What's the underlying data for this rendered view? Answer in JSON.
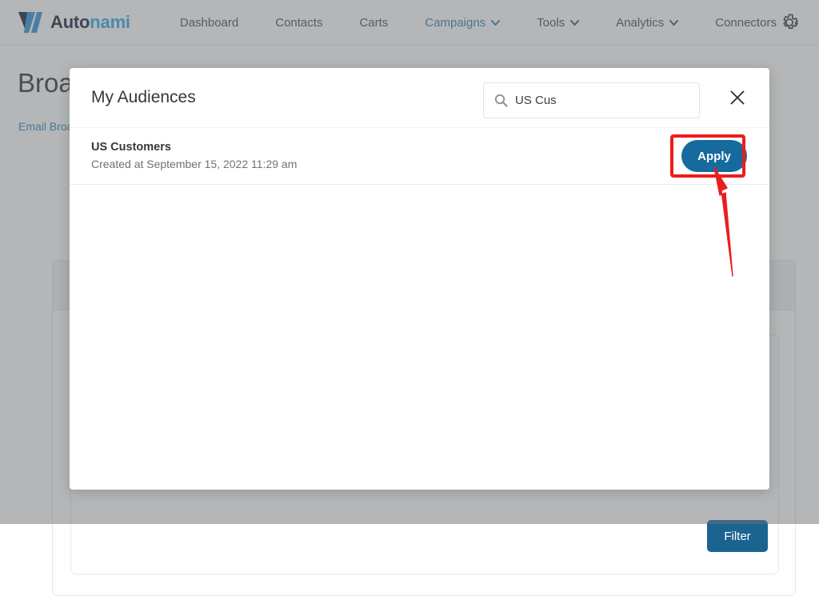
{
  "topbar": {
    "logo": {
      "icon": "autonami-logo-icon",
      "text_dark": "Auto",
      "text_light": "nami"
    },
    "nav_items": [
      {
        "label": "Dashboard",
        "has_caret": false,
        "active": false
      },
      {
        "label": "Contacts",
        "has_caret": false,
        "active": false
      },
      {
        "label": "Carts",
        "has_caret": false,
        "active": false
      },
      {
        "label": "Campaigns",
        "has_caret": true,
        "active": true
      },
      {
        "label": "Tools",
        "has_caret": true,
        "active": false
      },
      {
        "label": "Analytics",
        "has_caret": true,
        "active": false
      },
      {
        "label": "Connectors",
        "has_caret": false,
        "active": false
      }
    ],
    "settings_icon": "gear-icon"
  },
  "page": {
    "title": "Broadcasts",
    "breadcrumb": "Email Broadcasts",
    "filter_button": "Filter"
  },
  "modal": {
    "title": "My Audiences",
    "search": {
      "icon": "search-icon",
      "value": "US Cus",
      "placeholder": "Search"
    },
    "close_icon": "close-icon",
    "audiences": [
      {
        "name": "US Customers",
        "created": "Created at September 15, 2022 11:29 am",
        "apply_label": "Apply"
      }
    ]
  },
  "annotations": {
    "highlight_color": "#ec1c1c",
    "arrow_color": "#ec1c1c",
    "target": "Apply"
  },
  "colors": {
    "accent_blue": "#2b7fb5",
    "logo_light_blue": "#2ba6e0",
    "logo_dark": "#131c37",
    "button_blue": "#156a9e",
    "filter_blue": "#1b6491"
  }
}
